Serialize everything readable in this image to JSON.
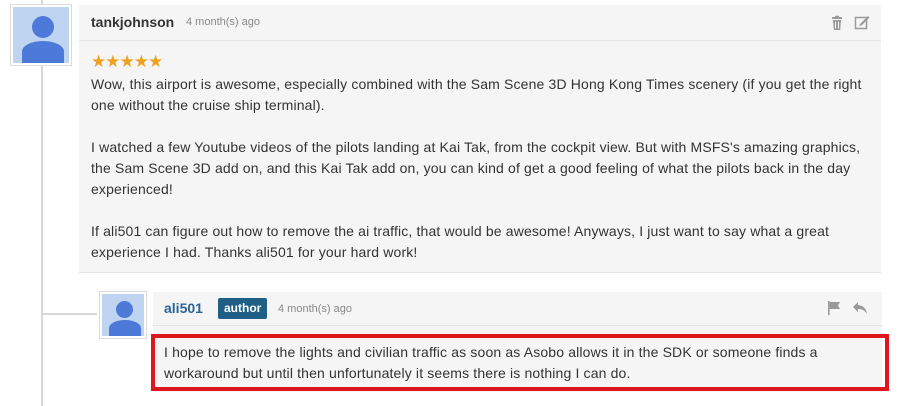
{
  "comment": {
    "username": "tankjohnson",
    "timestamp": "4 month(s) ago",
    "rating": "★★★★★",
    "paragraphs": [
      "Wow, this airport is awesome, especially combined with the Sam Scene 3D Hong Kong Times scenery (if you get the right one without the cruise ship terminal).",
      "I watched a few Youtube videos of the pilots landing at Kai Tak, from the cockpit view. But with MSFS's amazing graphics, the Sam Scene 3D add on, and this Kai Tak add on, you can kind of get a good feeling of what the pilots back in the day experienced!",
      "If ali501 can figure out how to remove the ai traffic, that would be awesome! Anyways, I just want to say what a great experience I had. Thanks ali501 for your hard work!"
    ],
    "icons": {
      "delete": "trash-icon",
      "edit": "edit-icon"
    }
  },
  "reply": {
    "username": "ali501",
    "badge": "author",
    "timestamp": "4 month(s) ago",
    "text": "I hope to remove the lights and civilian traffic as soon as Asobo allows it in the SDK or someone finds a workaround but until then unfortunately it seems there is nothing I can do.",
    "icons": {
      "report": "flag-icon",
      "reply": "reply-icon"
    }
  },
  "colors": {
    "accent": "#1f5f86",
    "star": "#f0a020",
    "highlight": "#e0161e",
    "avatar_bg": "#bfd4f0",
    "avatar_fg": "#4d7ad8"
  }
}
